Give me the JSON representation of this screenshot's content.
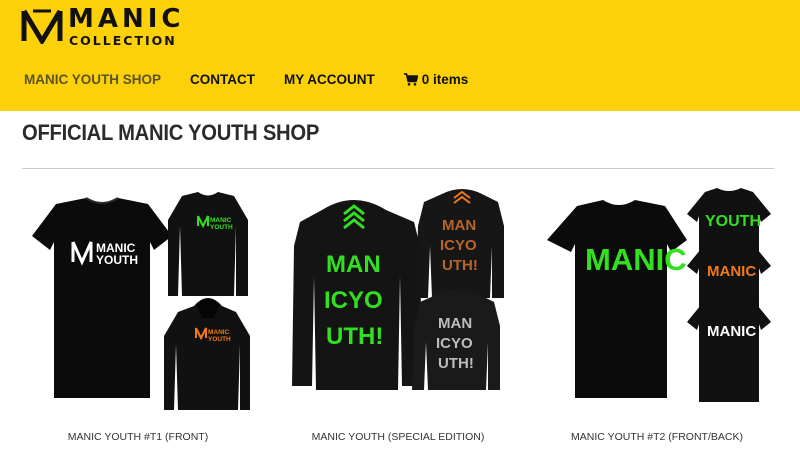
{
  "brand": {
    "word1": "MANIC",
    "word2": "COLLECTION"
  },
  "nav": {
    "items": [
      {
        "label": "MANIC YOUTH SHOP"
      },
      {
        "label": "CONTACT"
      },
      {
        "label": "MY ACCOUNT"
      },
      {
        "label": "0 items"
      }
    ],
    "cart_icon": "shopping-cart-icon"
  },
  "page": {
    "title": "OFFICIAL MANIC YOUTH SHOP"
  },
  "products": [
    {
      "name": "MANIC YOUTH #T1 (FRONT)",
      "print_main": "MANIC",
      "print_sub": "YOUTH",
      "print_mid": "MANIC YOUTH"
    },
    {
      "name": "MANIC YOUTH (SPECIAL EDITION)",
      "print_lines": [
        "MAN",
        "ICYO",
        "UTH!"
      ]
    },
    {
      "name": "MANIC YOUTH #T2 (FRONT/BACK)",
      "print_front": "MANIC",
      "print_back": [
        "YOUTH",
        "MANIC",
        "MANIC"
      ]
    }
  ],
  "colors": {
    "header_bg": "#fdd10a",
    "green": "#33e021",
    "orange": "#f07a1a",
    "white_print": "#ffffff",
    "grey_print": "#bdbdbd",
    "copper": "#b8642a"
  }
}
